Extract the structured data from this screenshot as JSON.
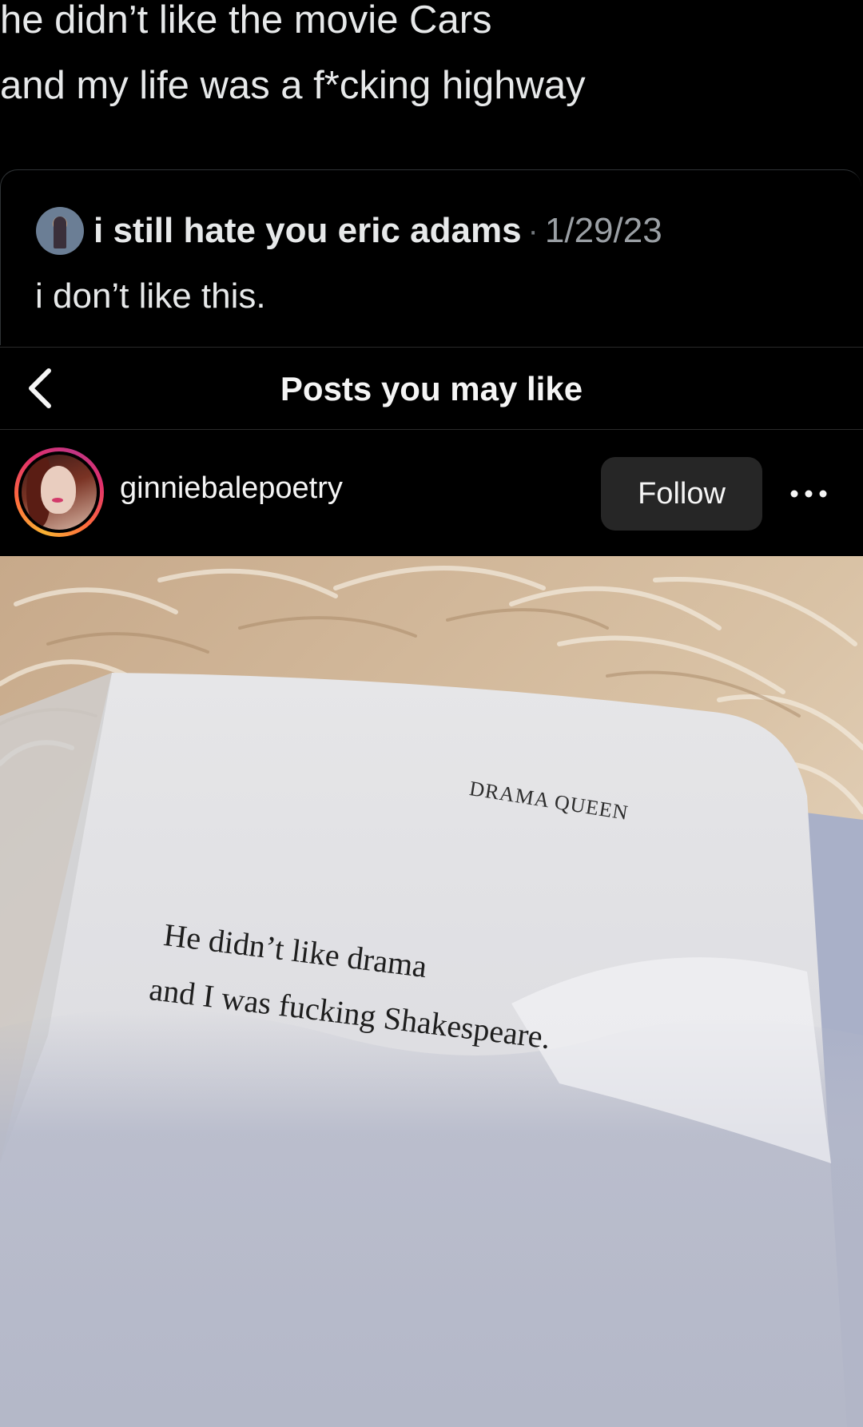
{
  "tweet": {
    "line1": "he didn’t like the movie Cars",
    "line2": "and my life was a f*cking highway"
  },
  "quoted_tweet": {
    "author": "i still hate you eric adams",
    "separator": "·",
    "date": "1/29/23",
    "text": "i don’t like this."
  },
  "nav": {
    "back_icon": "chevron-left-icon",
    "title": "Posts you may like"
  },
  "post": {
    "username": "ginniebalepoetry",
    "follow_label": "Follow",
    "more_icon": "more-horizontal-icon"
  },
  "image_text": {
    "heading": "DRAMA QUEEN",
    "line1": "He didn’t like drama",
    "line2": "and I was fucking Shakespeare."
  },
  "colors": {
    "background": "#000000",
    "text": "#e7e9ea",
    "muted": "#71767b",
    "follow_bg": "#262626"
  }
}
